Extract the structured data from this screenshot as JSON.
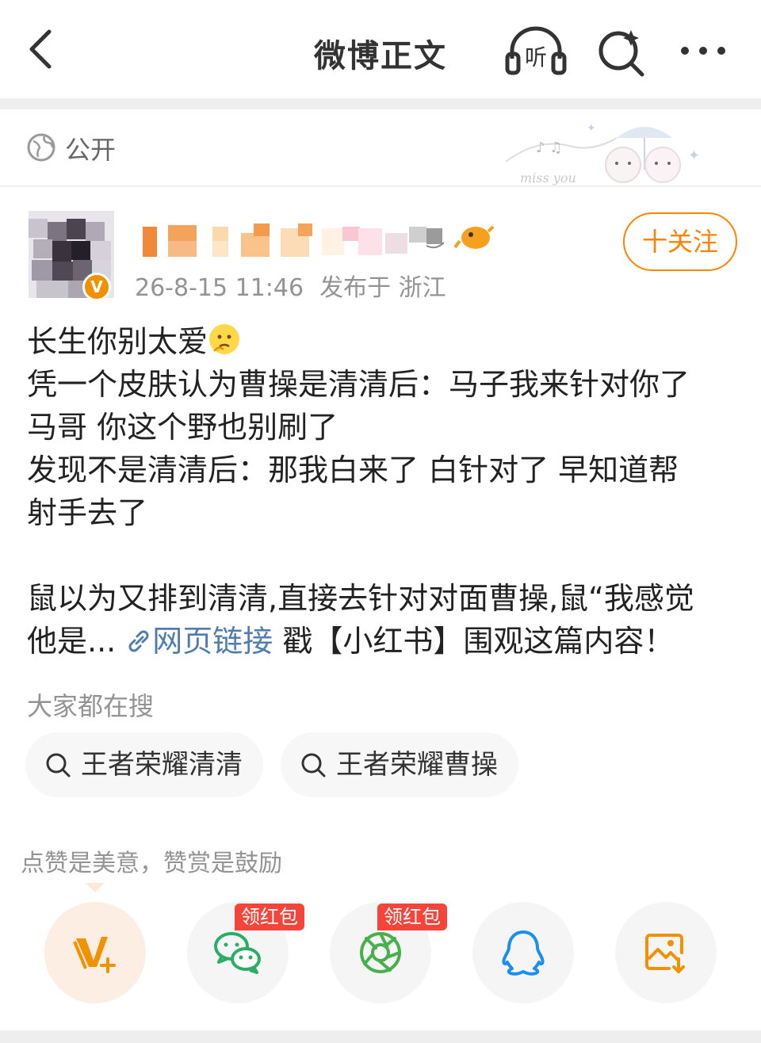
{
  "header": {
    "title": "微博正文",
    "listen_label": "听"
  },
  "visibility": {
    "label": "公开",
    "decoration_text": "miss you"
  },
  "post": {
    "verified_mark": "V",
    "timestamp": "26-8-15 11:46",
    "location": "发布于 浙江",
    "follow_label": "十关注",
    "lines": [
      "长生你别太爱",
      "凭一个皮肤认为曹操是清清后：马子我来针对你了",
      "马哥 你这个野也别刷了",
      "发现不是清清后：那我白来了 白针对了 早知道帮",
      "射手去了",
      "",
      "鼠以为又排到清清,直接去针对对面曹操,鼠“我感觉"
    ],
    "last_line_prefix": "他是...",
    "link_text": "网页链接",
    "last_line_suffix": " 戳【小红书】围观这篇内容！"
  },
  "trending": {
    "title": "大家都在搜",
    "chips": [
      "王者荣耀清清",
      "王者荣耀曹操"
    ]
  },
  "share": {
    "hint": "点赞是美意，赞赏是鼓励",
    "red_tag": "领红包",
    "buttons": [
      "reward-icon",
      "wechat-icon",
      "moments-icon",
      "qq-icon",
      "save-image-icon"
    ]
  },
  "colors": {
    "accent": "#ff8200",
    "link": "#507daf",
    "red_tag": "#f5443a"
  }
}
